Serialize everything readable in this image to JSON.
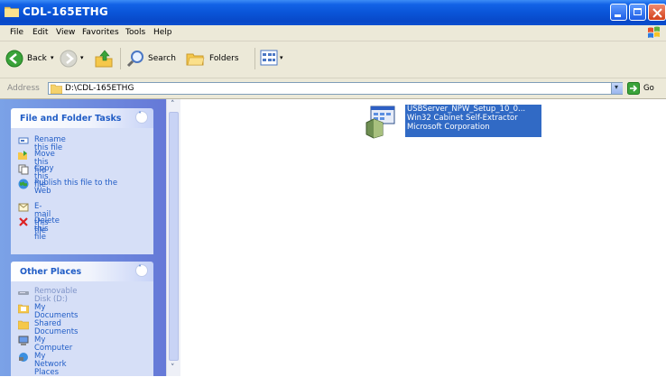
{
  "window": {
    "title": "CDL-165ETHG",
    "colors": {
      "titlebar": "#0a55d8",
      "close": "#d3421c",
      "menubar": "#ece9d8",
      "taskpane": "#6375d6"
    }
  },
  "menu": {
    "items": [
      "File",
      "Edit",
      "View",
      "Favorites",
      "Tools",
      "Help"
    ]
  },
  "toolbar": {
    "back_label": "Back",
    "search_label": "Search",
    "folders_label": "Folders"
  },
  "address": {
    "label": "Address",
    "value": "D:\\CDL-165ETHG",
    "go_label": "Go"
  },
  "file_tasks": {
    "title": "File and Folder Tasks",
    "items": [
      {
        "label": "Rename this file",
        "icon": "rename-icon"
      },
      {
        "label": "Move this file",
        "icon": "move-icon"
      },
      {
        "label": "Copy this file",
        "icon": "copy-icon"
      },
      {
        "label": "Publish this file to the\nWeb",
        "icon": "publish-icon"
      },
      {
        "label": "E-mail this file",
        "icon": "email-icon"
      },
      {
        "label": "Delete this file",
        "icon": "delete-icon"
      }
    ]
  },
  "other_places": {
    "title": "Other Places",
    "items": [
      {
        "label": "Removable Disk (D:)",
        "icon": "removable-disk-icon"
      },
      {
        "label": "My Documents",
        "icon": "folder-icon"
      },
      {
        "label": "Shared Documents",
        "icon": "folder-icon"
      },
      {
        "label": "My Computer",
        "icon": "computer-icon"
      },
      {
        "label": "My Network Places",
        "icon": "network-icon"
      }
    ]
  },
  "file": {
    "name": "USBServer_NPW_Setup_10_0...",
    "type": "Win32 Cabinet Self-Extractor",
    "company": "Microsoft Corporation"
  }
}
